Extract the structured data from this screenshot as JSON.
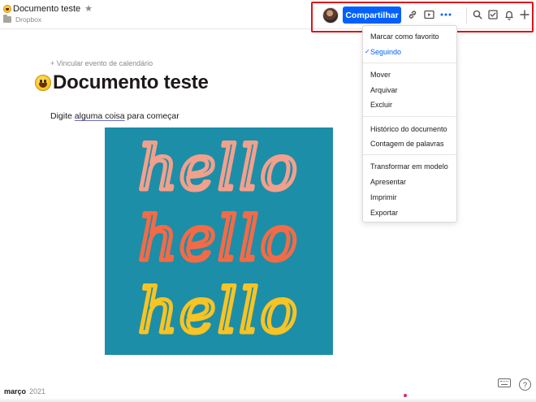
{
  "header": {
    "title": "Documento teste",
    "breadcrumb": "Dropbox",
    "share_label": "Compartilhar"
  },
  "toolbar_icons": [
    "link-icon",
    "present-icon",
    "more-icon",
    "search-icon",
    "checkbox-icon",
    "bell-icon",
    "plus-icon"
  ],
  "content": {
    "calendar_link": "+ Vincular evento de calendário",
    "page_title": "Documento teste",
    "body_before": "Digite ",
    "body_underlined": "alguma coisa",
    "body_after": " para começar",
    "image_text": [
      "hello",
      "hello",
      "hello"
    ]
  },
  "menu": {
    "items": [
      {
        "label": "Marcar como favorito"
      },
      {
        "label": "Seguindo",
        "selected": true
      },
      {
        "label": "Mover"
      },
      {
        "label": "Arquivar"
      },
      {
        "label": "Excluir"
      },
      {
        "label": "Histórico do documento"
      },
      {
        "label": "Contagem de palavras"
      },
      {
        "label": "Transformar em modelo"
      },
      {
        "label": "Apresentar"
      },
      {
        "label": "Imprimir"
      },
      {
        "label": "Exportar"
      }
    ],
    "check_glyph": "✓"
  },
  "footer": {
    "month": "março",
    "year": "2021",
    "help_glyph": "?"
  },
  "colors": {
    "accent": "#0061fe",
    "highlight_border": "#e0131a",
    "image_background": "#1c8ea8",
    "hello_pink": "#f2a08c",
    "hello_orange": "#f26b47",
    "hello_yellow": "#f7c325"
  }
}
